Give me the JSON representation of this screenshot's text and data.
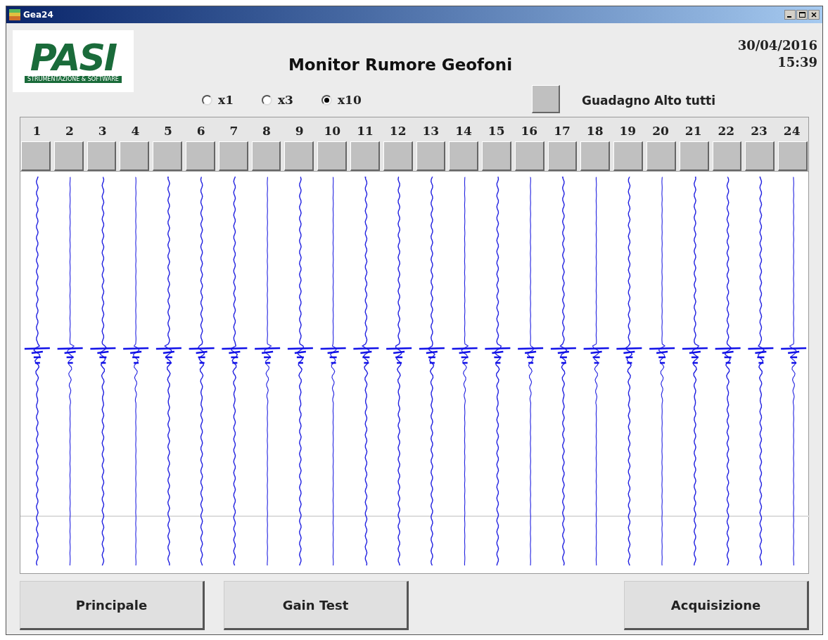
{
  "window": {
    "title": "Gea24"
  },
  "logo": {
    "name": "PASI",
    "tagline": "STRUMENTAZIONE & SOFTWARE"
  },
  "header": {
    "title": "Monitor Rumore Geofoni",
    "date": "30/04/2016",
    "time": "15:39"
  },
  "gain_options": [
    {
      "label": "x1",
      "selected": false
    },
    {
      "label": "x3",
      "selected": false
    },
    {
      "label": "x10",
      "selected": true
    }
  ],
  "gain_all": {
    "label": "Guadagno Alto tutti"
  },
  "channels": [
    {
      "label": "1"
    },
    {
      "label": "2"
    },
    {
      "label": "3"
    },
    {
      "label": "4"
    },
    {
      "label": "5"
    },
    {
      "label": "6"
    },
    {
      "label": "7"
    },
    {
      "label": "8"
    },
    {
      "label": "9"
    },
    {
      "label": "10"
    },
    {
      "label": "11"
    },
    {
      "label": "12"
    },
    {
      "label": "13"
    },
    {
      "label": "14"
    },
    {
      "label": "15"
    },
    {
      "label": "16"
    },
    {
      "label": "17"
    },
    {
      "label": "18"
    },
    {
      "label": "19"
    },
    {
      "label": "20"
    },
    {
      "label": "21"
    },
    {
      "label": "22"
    },
    {
      "label": "23"
    },
    {
      "label": "24"
    }
  ],
  "buttons": [
    "Principale",
    "Gain Test",
    "Acquisizione"
  ]
}
